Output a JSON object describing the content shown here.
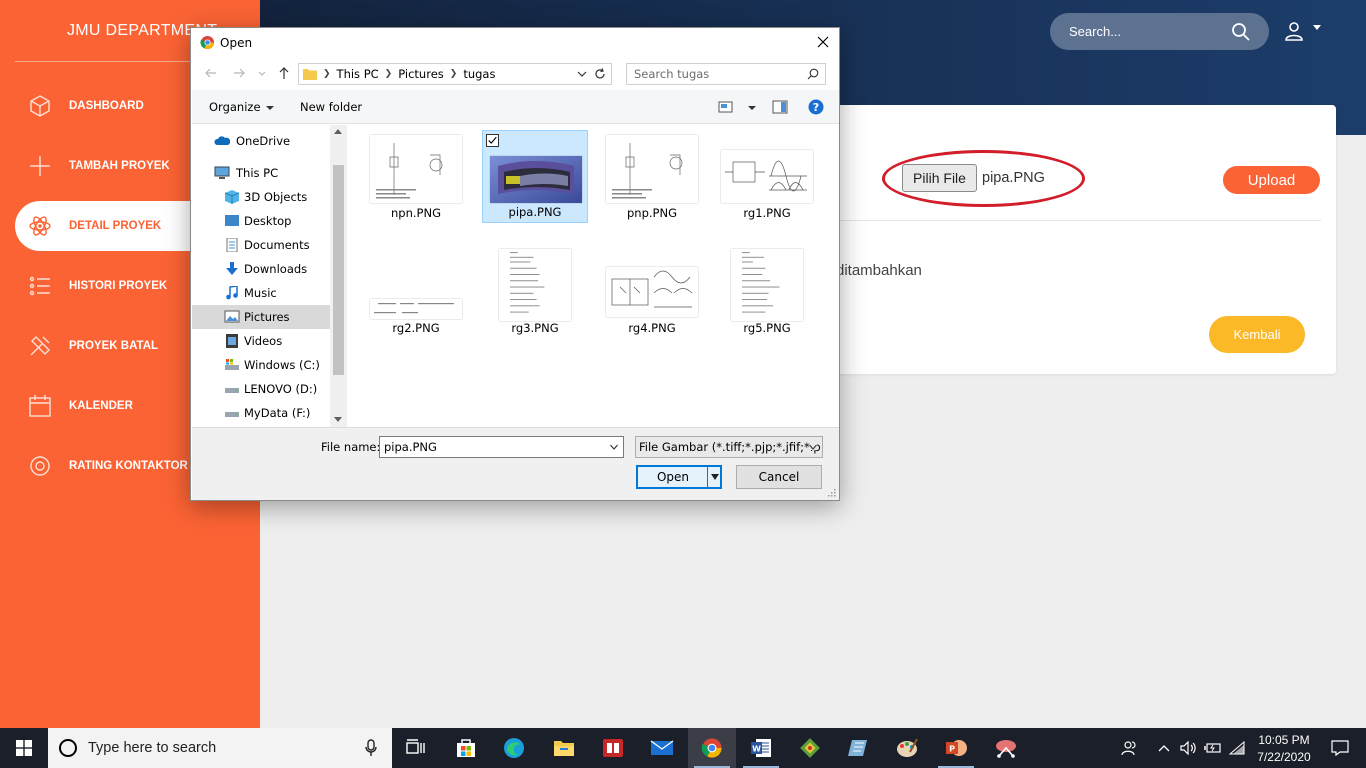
{
  "app": {
    "brand": "JMU DEPARTMENT",
    "nav": [
      {
        "label": "DASHBOARD",
        "icon": "cube-icon"
      },
      {
        "label": "TAMBAH PROYEK",
        "icon": "plus-icon"
      },
      {
        "label": "DETAIL PROYEK",
        "icon": "atom-icon",
        "active": true
      },
      {
        "label": "HISTORI PROYEK",
        "icon": "list-icon"
      },
      {
        "label": "PROYEK BATAL",
        "icon": "tools-icon"
      },
      {
        "label": "KALENDER",
        "icon": "calendar-icon"
      },
      {
        "label": "RATING KONTAKTOR",
        "icon": "rating-icon"
      }
    ],
    "search_placeholder": "Search...",
    "accent": "#fb6334",
    "header_gradient": [
      "#13233d",
      "#1c3d6b"
    ]
  },
  "upload_card": {
    "choose_label": "Pilih File",
    "file_name": "pipa.PNG",
    "upload_label": "Upload",
    "message": "ditambahkan",
    "back_label": "Kembali",
    "highlight_color": "#d21d2b"
  },
  "dialog": {
    "title": "Open",
    "breadcrumb": [
      "This PC",
      "Pictures",
      "tugas"
    ],
    "search_placeholder": "Search tugas",
    "organize_label": "Organize",
    "new_folder_label": "New folder",
    "nav_items": [
      {
        "label": "OneDrive",
        "icon": "onedrive-icon"
      },
      {
        "label": "This PC",
        "icon": "this-pc-icon"
      },
      {
        "label": "3D Objects",
        "icon": "3d-objects-icon"
      },
      {
        "label": "Desktop",
        "icon": "desktop-icon"
      },
      {
        "label": "Documents",
        "icon": "documents-icon"
      },
      {
        "label": "Downloads",
        "icon": "downloads-icon"
      },
      {
        "label": "Music",
        "icon": "music-icon"
      },
      {
        "label": "Pictures",
        "icon": "pictures-icon",
        "selected": true
      },
      {
        "label": "Videos",
        "icon": "videos-icon"
      },
      {
        "label": "Windows (C:)",
        "icon": "drive-c-icon"
      },
      {
        "label": "LENOVO (D:)",
        "icon": "drive-d-icon"
      },
      {
        "label": "MyData (F:)",
        "icon": "drive-f-icon"
      }
    ],
    "files": [
      {
        "name": "npn.PNG"
      },
      {
        "name": "pipa.PNG",
        "selected": true
      },
      {
        "name": "pnp.PNG"
      },
      {
        "name": "rg1.PNG"
      },
      {
        "name": "rg2.PNG"
      },
      {
        "name": "rg3.PNG"
      },
      {
        "name": "rg4.PNG"
      },
      {
        "name": "rg5.PNG"
      }
    ],
    "file_name_label": "File name:",
    "file_name_value": "pipa.PNG",
    "file_type": "File Gambar (*.tiff;*.pjp;*.jfif;*.p",
    "open_label": "Open",
    "cancel_label": "Cancel"
  },
  "taskbar": {
    "search_placeholder": "Type here to search",
    "time": "10:05 PM",
    "date": "7/22/2020"
  }
}
